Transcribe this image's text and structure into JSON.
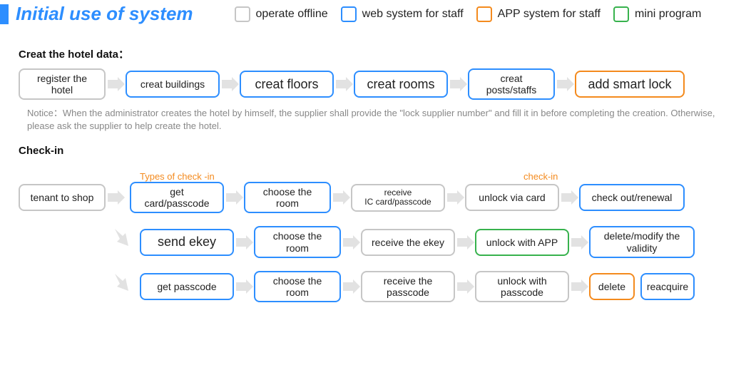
{
  "title": "Initial use of system",
  "legend": {
    "offline": "operate offline",
    "web": "web system for staff",
    "app": "APP system for staff",
    "mini": "mini program"
  },
  "createData": {
    "heading": "Creat the hotel data：",
    "steps": {
      "register": "register the hotel",
      "buildings": "creat buildings",
      "floors": "creat floors",
      "rooms": "creat rooms",
      "posts": "creat posts/staffs",
      "lock": "add smart lock"
    },
    "notice": "Notice：When the administrator creates the hotel by himself, the supplier shall provide the \"lock supplier number\" and fill it in before completing the creation. Otherwise, please ask the supplier to help create the hotel."
  },
  "checkin": {
    "heading": "Check-in",
    "labels": {
      "types": "Types of check -in",
      "checkin": "check-in"
    },
    "tenant": "tenant to shop",
    "row1": {
      "a": "get card/passcode",
      "b": "choose the room",
      "c": "receive\nIC card/passcode",
      "d": "unlock via card",
      "e": "check out/renewal"
    },
    "row2": {
      "a": "send ekey",
      "b": "choose the room",
      "c": "receive the ekey",
      "d": "unlock with APP",
      "e": "delete/modify the validity"
    },
    "row3": {
      "a": "get passcode",
      "b": "choose the room",
      "c": "receive the passcode",
      "d": "unlock with passcode",
      "e1": "delete",
      "e2": "reacquire"
    }
  }
}
